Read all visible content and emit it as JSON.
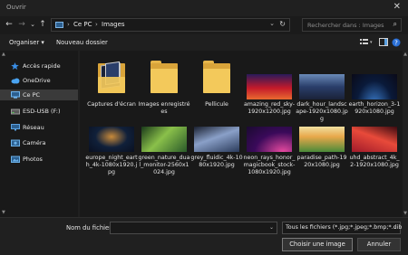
{
  "window": {
    "title": "Ouvrir"
  },
  "nav": {
    "back": "←",
    "forward": "→",
    "up_menu": "⌄",
    "up": "↑"
  },
  "address": {
    "root": "Ce PC",
    "current": "Images",
    "separator": "›"
  },
  "search": {
    "placeholder": "Rechercher dans : Images"
  },
  "toolbar": {
    "organize": "Organiser",
    "organize_caret": "▾",
    "new_folder": "Nouveau dossier"
  },
  "sidebar": {
    "items": [
      {
        "label": "Accès rapide",
        "icon": "star-icon",
        "color": "#3a8ee6"
      },
      {
        "label": "OneDrive",
        "icon": "cloud-icon",
        "color": "#4aa3f0"
      },
      {
        "label": "Ce PC",
        "icon": "computer-icon",
        "color": "#6fb6f0"
      },
      {
        "label": "ESD-USB (F:)",
        "icon": "usb-drive-icon",
        "color": "#9a9a9a"
      },
      {
        "label": "Réseau",
        "icon": "network-icon",
        "color": "#5aa0e0"
      },
      {
        "label": "Caméra",
        "icon": "camera-folder-icon",
        "color": "#6ab0e8"
      },
      {
        "label": "Photos",
        "icon": "photos-folder-icon",
        "color": "#6ab0e8"
      }
    ]
  },
  "files": [
    {
      "name": "Captures d'écran",
      "kind": "folder-with-screenshots"
    },
    {
      "name": "Images enregistrées",
      "kind": "folder"
    },
    {
      "name": "Pellicule",
      "kind": "folder"
    },
    {
      "name": "amazing_red_sky-1920x1200.jpg",
      "kind": "image",
      "colors": [
        "#c41a2a",
        "#2a1a5a",
        "#e86a30"
      ]
    },
    {
      "name": "dark_hour_landscape-1920x1080.jpg",
      "kind": "image",
      "colors": [
        "#2a3e6a",
        "#6a8ab8",
        "#1a2238"
      ]
    },
    {
      "name": "earth_horizon_3-1920x1080.jpg",
      "kind": "image",
      "colors": [
        "#0a1a3a",
        "#3a7ac8",
        "#0a0a18"
      ]
    },
    {
      "name": "europe_night_earth_4k-1080x1920.jpg",
      "kind": "image",
      "colors": [
        "#0a1020",
        "#c88a3a",
        "#10203a"
      ]
    },
    {
      "name": "green_nature_dual_monitor-2560x1024.jpg",
      "kind": "image",
      "colors": [
        "#2a5a2a",
        "#8ac04a",
        "#1a3a1a"
      ]
    },
    {
      "name": "grey_fluidic_4k-1080x1920.jpg",
      "kind": "image",
      "colors": [
        "#2a3a5a",
        "#8aa0c8",
        "#1a2030"
      ]
    },
    {
      "name": "neon_rays_honor_magicbook_stock-1080x1920.jpg",
      "kind": "image",
      "colors": [
        "#3a0a5a",
        "#e84aa0",
        "#1a0a30"
      ]
    },
    {
      "name": "paradise_path-1920x1080.jpg",
      "kind": "image",
      "colors": [
        "#e8a84a",
        "#4a8a3a",
        "#f0e0a0"
      ]
    },
    {
      "name": "uhd_abstract_4k_2-1920x1080.jpg",
      "kind": "image",
      "colors": [
        "#a01a2a",
        "#e84a3a",
        "#3a0a10"
      ]
    }
  ],
  "footer": {
    "filename_label": "Nom du fichier :",
    "filename_value": "",
    "filetype": "Tous les fichiers (*.jpg;*.jpeg;*.bmp;*.dib",
    "open_button": "Choisir une image",
    "cancel_button": "Annuler"
  },
  "colors": {
    "background": "#191919",
    "folder": "#f3c95b",
    "accent": "#3a8ee6"
  }
}
